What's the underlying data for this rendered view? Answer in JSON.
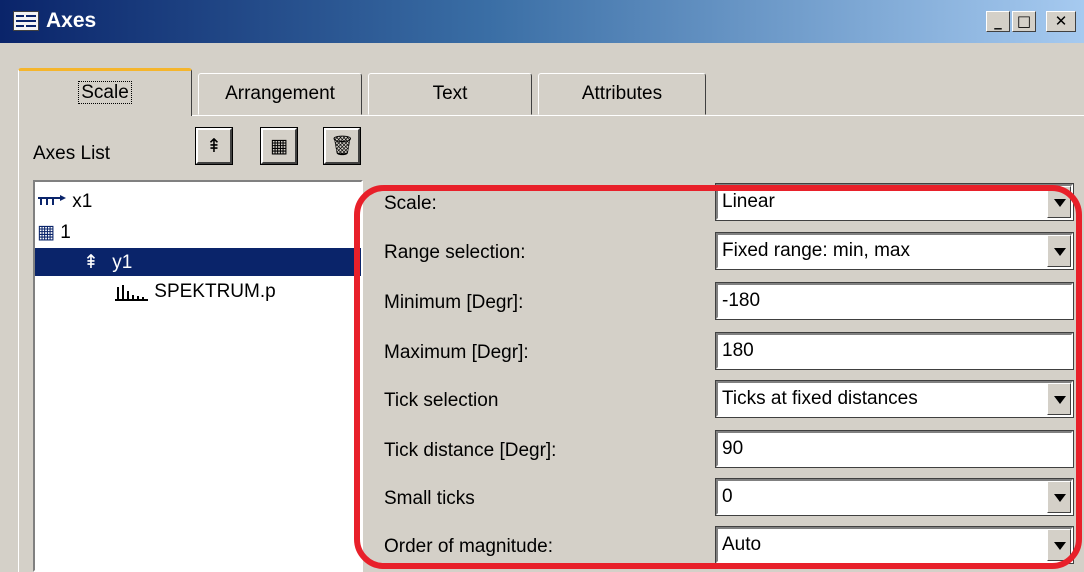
{
  "window": {
    "title": "Axes"
  },
  "tabs": [
    {
      "label": "Scale",
      "active": true
    },
    {
      "label": "Arrangement"
    },
    {
      "label": "Text"
    },
    {
      "label": "Attributes"
    }
  ],
  "axes_list": {
    "label": "Axes List",
    "buttons": [
      "new-axis-icon",
      "coordinate-system-icon",
      "trash-icon"
    ],
    "items": [
      {
        "label": "x1",
        "icon": "x-axis-icon"
      },
      {
        "label": "1",
        "icon": "coordinate-system-icon"
      },
      {
        "label": "y1",
        "icon": "y-axis-icon",
        "selected": true
      },
      {
        "label": "SPEKTRUM.p",
        "icon": "spectrum-icon"
      }
    ]
  },
  "fields": [
    {
      "label": "Scale:",
      "value": "Linear",
      "type": "dropdown"
    },
    {
      "label": "Range selection:",
      "value": "Fixed range: min, max",
      "type": "dropdown"
    },
    {
      "label": "Minimum [Degr]:",
      "value": "-180",
      "type": "text"
    },
    {
      "label": "Maximum [Degr]:",
      "value": "180",
      "type": "text"
    },
    {
      "label": "Tick selection",
      "value": "Ticks at fixed distances",
      "type": "dropdown"
    },
    {
      "label": "Tick distance [Degr]:",
      "value": "90",
      "type": "text"
    },
    {
      "label": "Small ticks",
      "value": "0",
      "type": "dropdown"
    },
    {
      "label": "Order of magnitude:",
      "value": "Auto",
      "type": "dropdown"
    }
  ],
  "colors": {
    "title_start": "#0a246a",
    "title_end": "#a6caf0",
    "selection": "#0a246a",
    "highlight": "#e8202a",
    "tab_accent": "#f5b52c"
  }
}
